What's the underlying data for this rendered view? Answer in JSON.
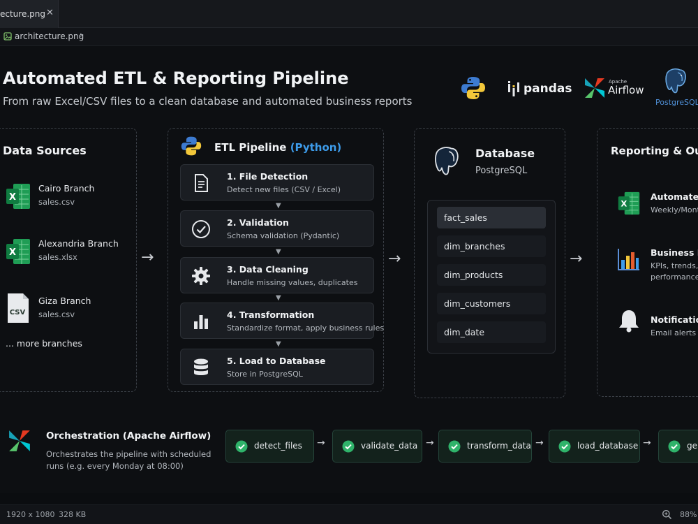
{
  "tab": {
    "title": "ecture.png",
    "close": "✕"
  },
  "breadcrumb": {
    "file": "architecture.png",
    "chevron": "›"
  },
  "header": {
    "title": "Automated ETL & Reporting Pipeline",
    "subtitle": "From raw Excel/CSV files to a clean database and automated business reports"
  },
  "logos": {
    "pandas": "pandas",
    "airflow_small": "Apache",
    "airflow": "Airflow",
    "postgres": "PostgreSQL"
  },
  "sources": {
    "title": "Data Sources",
    "items": [
      {
        "name": "Cairo Branch",
        "file": "sales.csv",
        "icon": "excel-icon"
      },
      {
        "name": "Alexandria Branch",
        "file": "sales.xlsx",
        "icon": "excel-icon"
      },
      {
        "name": "Giza Branch",
        "file": "sales.csv",
        "icon": "csv-file-icon",
        "badge": "CSV"
      }
    ],
    "more": "... more branches"
  },
  "pipeline": {
    "title": "ETL Pipeline",
    "title_accent": "(Python)",
    "steps": [
      {
        "title": "1. File Detection",
        "desc": "Detect new files (CSV / Excel)",
        "icon": "document-icon"
      },
      {
        "title": "2. Validation",
        "desc": "Schema validation (Pydantic)",
        "icon": "check-circle-icon"
      },
      {
        "title": "3. Data Cleaning",
        "desc": "Handle missing values, duplicates",
        "icon": "gear-icon"
      },
      {
        "title": "4. Transformation",
        "desc": "Standardize format, apply business rules",
        "icon": "bar-chart-icon"
      },
      {
        "title": "5. Load to Database",
        "desc": "Store in PostgreSQL",
        "icon": "database-icon"
      }
    ]
  },
  "database": {
    "title": "Database",
    "subtitle": "PostgreSQL",
    "tables": [
      "fact_sales",
      "dim_branches",
      "dim_products",
      "dim_customers",
      "dim_date"
    ]
  },
  "reporting": {
    "title": "Reporting & Out",
    "items": [
      {
        "title": "Automated",
        "desc": "Weekly/Month",
        "desc2": "",
        "icon": "excel-icon"
      },
      {
        "title": "Business Ins",
        "desc": "KPIs, trends, b",
        "desc2": "performance",
        "icon": "bar-chart-icon"
      },
      {
        "title": "Notification",
        "desc": "Email alerts (",
        "desc2": "",
        "icon": "bell-icon"
      }
    ]
  },
  "orchestration": {
    "title": "Orchestration (Apache Airflow)",
    "desc": "Orchestrates the pipeline with scheduled runs (e.g. every Monday at 08:00)",
    "tasks": [
      "detect_files",
      "validate_data",
      "transform_data",
      "load_database",
      "gen"
    ]
  },
  "status": {
    "dimensions": "1920 x 1080",
    "size": "328 KB",
    "zoom": "88%"
  },
  "colors": {
    "accent": "#3d9be9",
    "check": "#2fb36a",
    "excel": "#1f9d55"
  }
}
